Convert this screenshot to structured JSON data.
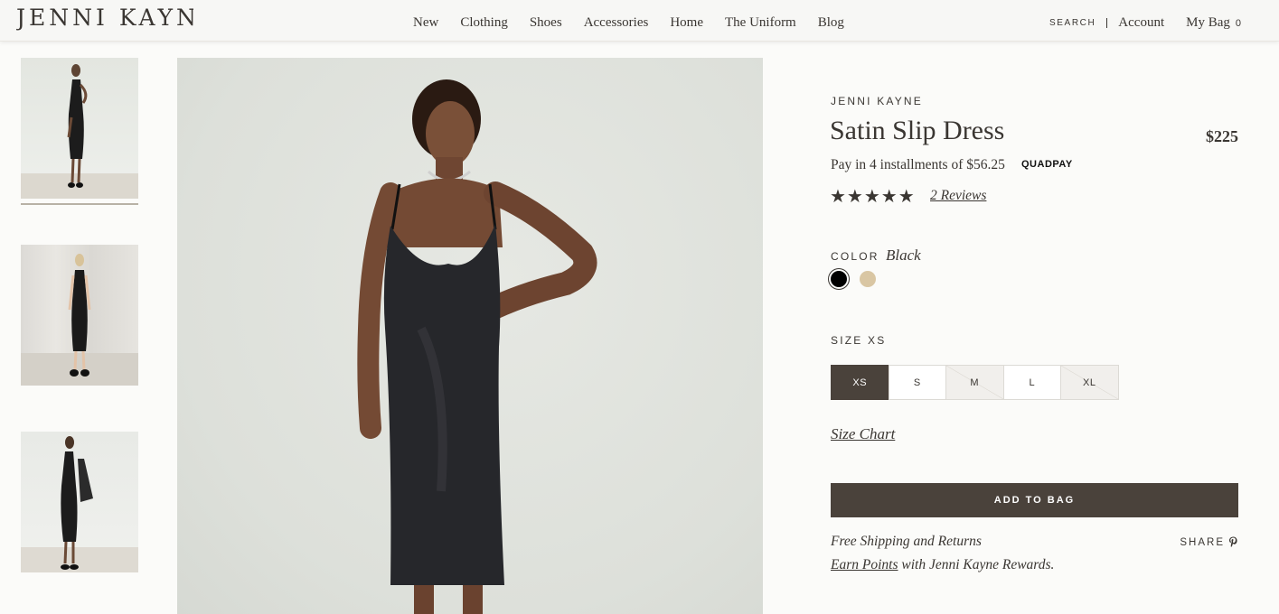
{
  "header": {
    "logo": "Jenni Kayne",
    "nav": [
      "New",
      "Clothing",
      "Shoes",
      "Accessories",
      "Home",
      "The Uniform",
      "Blog"
    ],
    "search": "SEARCH",
    "account": "Account",
    "bag_label": "My Bag",
    "bag_count": "0"
  },
  "product": {
    "brand": "JENNI KAYNE",
    "title": "Satin Slip Dress",
    "price": "$225",
    "installments": "Pay in 4 installments of $56.25",
    "quadpay": "QUADPAY",
    "rating": 5,
    "stars": "★★★★★",
    "reviews": "2 Reviews",
    "color_label": "COLOR",
    "color_value": "Black",
    "colors": [
      {
        "name": "Black",
        "hex": "#000000"
      },
      {
        "name": "Tan",
        "hex": "#d9c6a3"
      }
    ],
    "size_label": "SIZE XS",
    "sizes": [
      {
        "label": "XS",
        "selected": true,
        "available": true
      },
      {
        "label": "S",
        "selected": false,
        "available": true
      },
      {
        "label": "M",
        "selected": false,
        "available": false
      },
      {
        "label": "L",
        "selected": false,
        "available": true
      },
      {
        "label": "XL",
        "selected": false,
        "available": false
      }
    ],
    "size_chart": "Size Chart",
    "add_to_bag": "ADD TO BAG",
    "shipping": "Free Shipping and Returns",
    "rewards_link": "Earn Points",
    "rewards_rest": " with Jenni Kayne Rewards.",
    "share": "SHARE"
  },
  "colors": {
    "accent": "#4a423b",
    "text": "#3a3632",
    "background": "#fbfbf9"
  }
}
